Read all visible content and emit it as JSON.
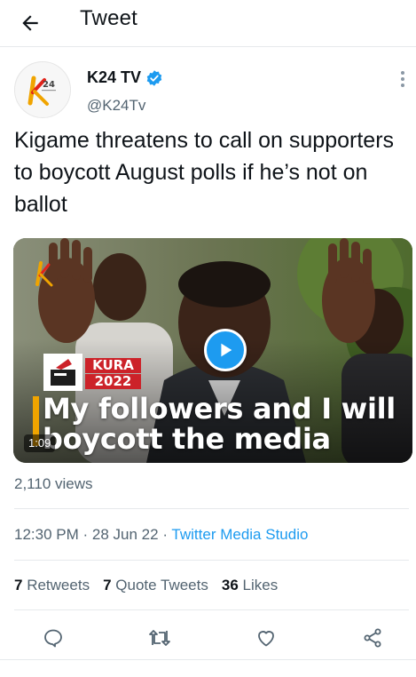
{
  "header": {
    "title": "Tweet",
    "back_icon": "arrow-left-icon"
  },
  "author": {
    "display_name": "K24 TV",
    "handle": "@K24Tv",
    "verified": true,
    "avatar_text": "24",
    "brand_color": "#f0a400"
  },
  "tweet": {
    "text": "Kigame threatens to call on supporters to boycott August polls if he’s not on ballot"
  },
  "media": {
    "badge_word": "KURA",
    "badge_year": "2022",
    "caption_line1": "My followers and I will",
    "caption_line2": "boycott the media",
    "duration": "1:09",
    "play_icon": "play-icon"
  },
  "views": "2,110 views",
  "meta": {
    "time": "12:30 PM",
    "date": "28 Jun 22",
    "source": "Twitter Media Studio",
    "separator": "·"
  },
  "stats": {
    "retweets_count": "7",
    "retweets_label": "Retweets",
    "quotes_count": "7",
    "quotes_label": "Quote Tweets",
    "likes_count": "36",
    "likes_label": "Likes"
  },
  "actions": [
    "reply-icon",
    "retweet-icon",
    "like-icon",
    "share-icon"
  ],
  "colors": {
    "accent": "#1d9bf0",
    "secondary_text": "#536471",
    "primary_text": "#0f1419",
    "badge_red": "#cc2229"
  }
}
